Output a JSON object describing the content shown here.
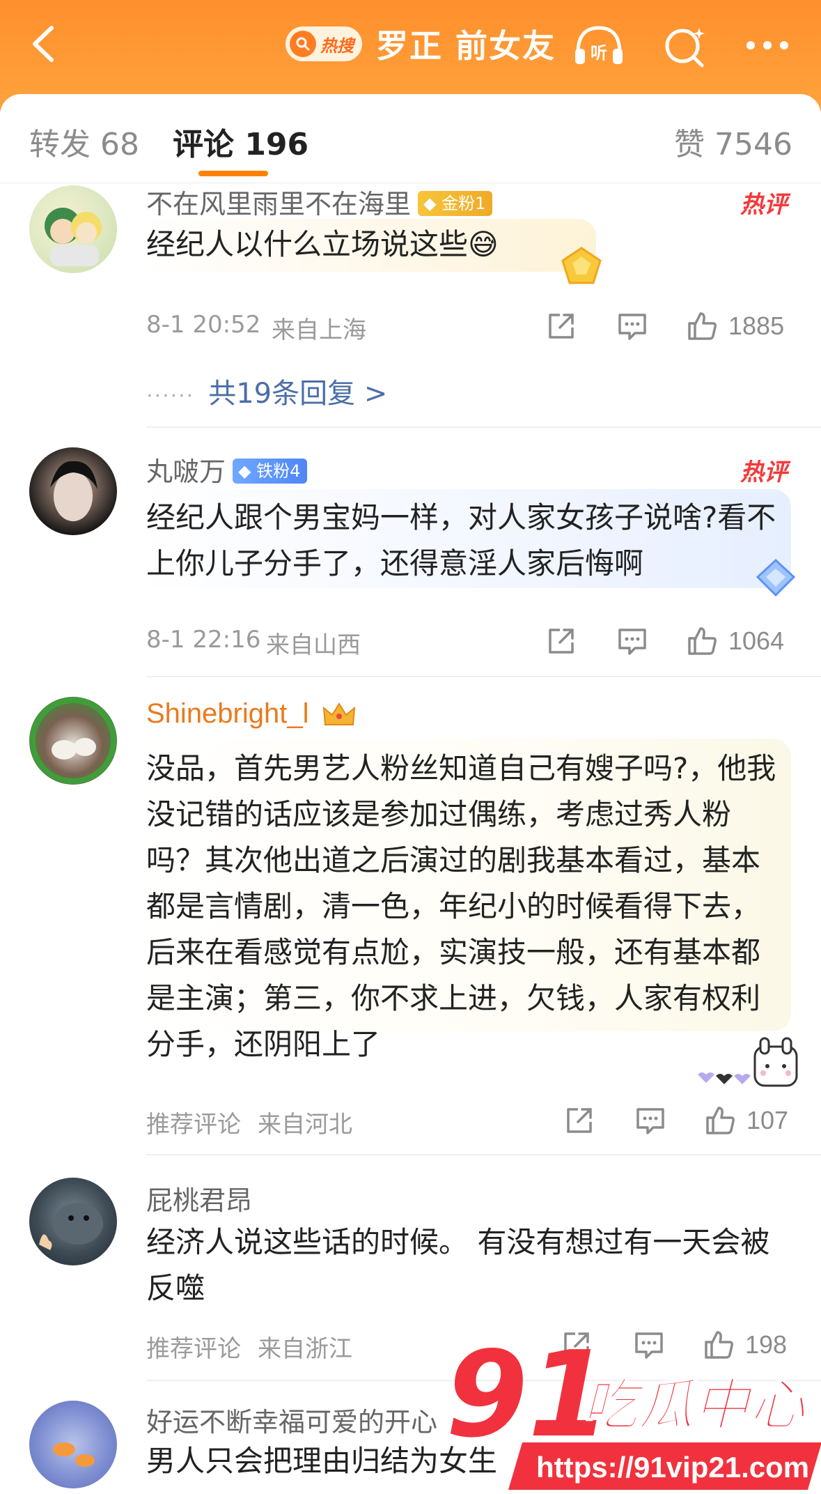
{
  "header": {
    "back": "back-arrow-icon",
    "hot_badge": "热搜",
    "title": "罗正 前女友",
    "listen": "听",
    "colors": {
      "bar": "#ff8f2c",
      "accent": "#ff8200",
      "hot_red": "#f4393a",
      "link": "#4b6ea8"
    }
  },
  "tabs": {
    "repost": "转发 68",
    "comments": "评论 196",
    "likes": "赞 7546"
  },
  "comments": [
    {
      "user": "不在风里雨里不在海里",
      "badge": "金粉1",
      "hot": "热评",
      "text": "经纪人以什么立场说这些",
      "emoji": "😅",
      "time": "8-1 20:52",
      "location": "来自上海",
      "likes": "1885",
      "replies": "共19条回复 >",
      "replies_dots": "······"
    },
    {
      "user": "丸啵万",
      "badge": "铁粉4",
      "hot": "热评",
      "text": "经纪人跟个男宝妈一样，对人家女孩子说啥?看不上你儿子分手了，还得意淫人家后悔啊",
      "time": "8-1 22:16",
      "location": "来自山西",
      "likes": "1064"
    },
    {
      "user": "Shinebright_l",
      "text": "没品，首先男艺人粉丝知道自己有嫂子吗?，他我没记错的话应该是参加过偶练，考虑过秀人粉吗？其次他出道之后演过的剧我基本看过，基本都是言情剧，清一色，年纪小的时候看得下去，后来在看感觉有点尬，实演技一般，还有基本都是主演；第三，你不求上进，欠钱，人家有权利分手，还阴阳上了",
      "time": "推荐评论",
      "location": "来自河北",
      "likes": "107"
    },
    {
      "user": "屁桃君昂",
      "text": "经济人说这些话的时候。 有没有想过有一天会被反噬",
      "time": "推荐评论",
      "location": "来自浙江",
      "likes": "198"
    },
    {
      "user": "好运不断幸福可爱的开心",
      "text": "男人只会把理由归结为女生"
    }
  ],
  "watermark": {
    "big": "91",
    "cn": "吃瓜中心",
    "url": "https://91vip21.com"
  }
}
